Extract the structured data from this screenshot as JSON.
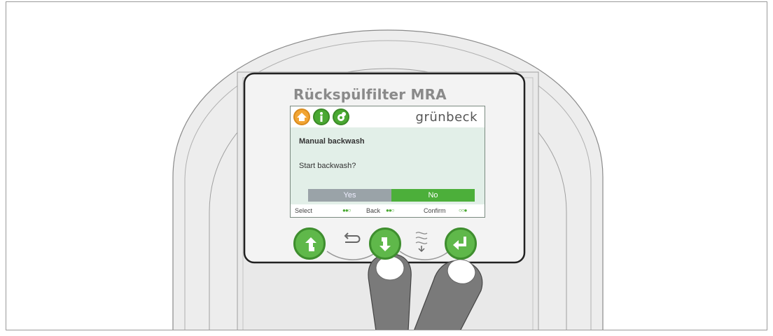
{
  "device": {
    "product_name": "Rückspülfilter MRA",
    "brand": "grünbeck"
  },
  "screen": {
    "icons": [
      "home-icon",
      "info-icon",
      "settings-icon"
    ],
    "heading": "Manual backwash",
    "question": "Start backwash?",
    "options": {
      "yes": "Yes",
      "no": "No",
      "selected": "No"
    },
    "hints": {
      "select": "Select",
      "back": "Back",
      "confirm": "Confirm"
    },
    "hint_dots": {
      "select": "●●○",
      "back": "●●○",
      "confirm": "○○●"
    }
  },
  "colors": {
    "accent_green": "#4caf3a",
    "home_orange": "#f2a533",
    "screen_bg": "#e2efe8",
    "unselected_gray": "#9aa3a8"
  },
  "hardware_buttons": [
    "select-up-button",
    "select-down-button",
    "confirm-button"
  ]
}
